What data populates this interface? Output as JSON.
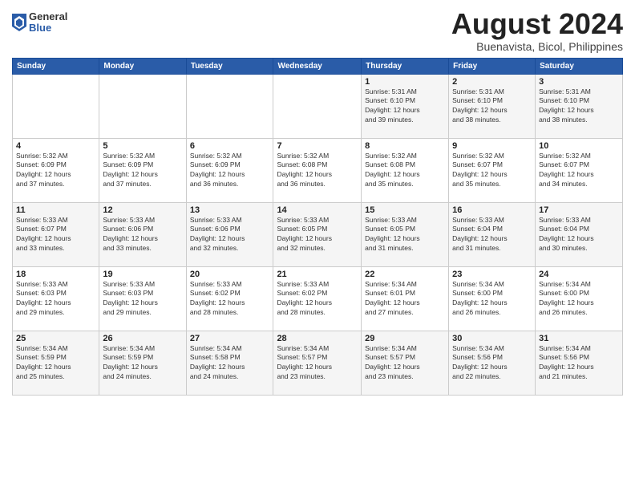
{
  "header": {
    "logo_general": "General",
    "logo_blue": "Blue",
    "title": "August 2024",
    "location": "Buenavista, Bicol, Philippines"
  },
  "days_of_week": [
    "Sunday",
    "Monday",
    "Tuesday",
    "Wednesday",
    "Thursday",
    "Friday",
    "Saturday"
  ],
  "weeks": [
    [
      {
        "day": "",
        "info": ""
      },
      {
        "day": "",
        "info": ""
      },
      {
        "day": "",
        "info": ""
      },
      {
        "day": "",
        "info": ""
      },
      {
        "day": "1",
        "info": "Sunrise: 5:31 AM\nSunset: 6:10 PM\nDaylight: 12 hours\nand 39 minutes."
      },
      {
        "day": "2",
        "info": "Sunrise: 5:31 AM\nSunset: 6:10 PM\nDaylight: 12 hours\nand 38 minutes."
      },
      {
        "day": "3",
        "info": "Sunrise: 5:31 AM\nSunset: 6:10 PM\nDaylight: 12 hours\nand 38 minutes."
      }
    ],
    [
      {
        "day": "4",
        "info": "Sunrise: 5:32 AM\nSunset: 6:09 PM\nDaylight: 12 hours\nand 37 minutes."
      },
      {
        "day": "5",
        "info": "Sunrise: 5:32 AM\nSunset: 6:09 PM\nDaylight: 12 hours\nand 37 minutes."
      },
      {
        "day": "6",
        "info": "Sunrise: 5:32 AM\nSunset: 6:09 PM\nDaylight: 12 hours\nand 36 minutes."
      },
      {
        "day": "7",
        "info": "Sunrise: 5:32 AM\nSunset: 6:08 PM\nDaylight: 12 hours\nand 36 minutes."
      },
      {
        "day": "8",
        "info": "Sunrise: 5:32 AM\nSunset: 6:08 PM\nDaylight: 12 hours\nand 35 minutes."
      },
      {
        "day": "9",
        "info": "Sunrise: 5:32 AM\nSunset: 6:07 PM\nDaylight: 12 hours\nand 35 minutes."
      },
      {
        "day": "10",
        "info": "Sunrise: 5:32 AM\nSunset: 6:07 PM\nDaylight: 12 hours\nand 34 minutes."
      }
    ],
    [
      {
        "day": "11",
        "info": "Sunrise: 5:33 AM\nSunset: 6:07 PM\nDaylight: 12 hours\nand 33 minutes."
      },
      {
        "day": "12",
        "info": "Sunrise: 5:33 AM\nSunset: 6:06 PM\nDaylight: 12 hours\nand 33 minutes."
      },
      {
        "day": "13",
        "info": "Sunrise: 5:33 AM\nSunset: 6:06 PM\nDaylight: 12 hours\nand 32 minutes."
      },
      {
        "day": "14",
        "info": "Sunrise: 5:33 AM\nSunset: 6:05 PM\nDaylight: 12 hours\nand 32 minutes."
      },
      {
        "day": "15",
        "info": "Sunrise: 5:33 AM\nSunset: 6:05 PM\nDaylight: 12 hours\nand 31 minutes."
      },
      {
        "day": "16",
        "info": "Sunrise: 5:33 AM\nSunset: 6:04 PM\nDaylight: 12 hours\nand 31 minutes."
      },
      {
        "day": "17",
        "info": "Sunrise: 5:33 AM\nSunset: 6:04 PM\nDaylight: 12 hours\nand 30 minutes."
      }
    ],
    [
      {
        "day": "18",
        "info": "Sunrise: 5:33 AM\nSunset: 6:03 PM\nDaylight: 12 hours\nand 29 minutes."
      },
      {
        "day": "19",
        "info": "Sunrise: 5:33 AM\nSunset: 6:03 PM\nDaylight: 12 hours\nand 29 minutes."
      },
      {
        "day": "20",
        "info": "Sunrise: 5:33 AM\nSunset: 6:02 PM\nDaylight: 12 hours\nand 28 minutes."
      },
      {
        "day": "21",
        "info": "Sunrise: 5:33 AM\nSunset: 6:02 PM\nDaylight: 12 hours\nand 28 minutes."
      },
      {
        "day": "22",
        "info": "Sunrise: 5:34 AM\nSunset: 6:01 PM\nDaylight: 12 hours\nand 27 minutes."
      },
      {
        "day": "23",
        "info": "Sunrise: 5:34 AM\nSunset: 6:00 PM\nDaylight: 12 hours\nand 26 minutes."
      },
      {
        "day": "24",
        "info": "Sunrise: 5:34 AM\nSunset: 6:00 PM\nDaylight: 12 hours\nand 26 minutes."
      }
    ],
    [
      {
        "day": "25",
        "info": "Sunrise: 5:34 AM\nSunset: 5:59 PM\nDaylight: 12 hours\nand 25 minutes."
      },
      {
        "day": "26",
        "info": "Sunrise: 5:34 AM\nSunset: 5:59 PM\nDaylight: 12 hours\nand 24 minutes."
      },
      {
        "day": "27",
        "info": "Sunrise: 5:34 AM\nSunset: 5:58 PM\nDaylight: 12 hours\nand 24 minutes."
      },
      {
        "day": "28",
        "info": "Sunrise: 5:34 AM\nSunset: 5:57 PM\nDaylight: 12 hours\nand 23 minutes."
      },
      {
        "day": "29",
        "info": "Sunrise: 5:34 AM\nSunset: 5:57 PM\nDaylight: 12 hours\nand 23 minutes."
      },
      {
        "day": "30",
        "info": "Sunrise: 5:34 AM\nSunset: 5:56 PM\nDaylight: 12 hours\nand 22 minutes."
      },
      {
        "day": "31",
        "info": "Sunrise: 5:34 AM\nSunset: 5:56 PM\nDaylight: 12 hours\nand 21 minutes."
      }
    ]
  ]
}
